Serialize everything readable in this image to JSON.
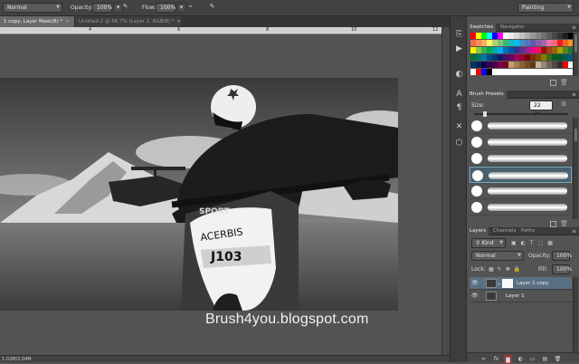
{
  "options_bar": {
    "mode_value": "Normal",
    "opacity_label": "Opacity:",
    "opacity_value": "100%",
    "flow_label": "Flow:",
    "flow_value": "100%",
    "workspace_value": "Painting"
  },
  "tabs": [
    {
      "label": "1 copy, Layer Mask/8) *",
      "close": "×"
    },
    {
      "label": "Untitled-2 @ 66.7% (Layer 2, RGB/8) *",
      "close": "×"
    }
  ],
  "ruler": {
    "ticks": [
      "",
      "4",
      "6",
      "8",
      "10",
      "12"
    ]
  },
  "status": {
    "doc_size": "1.02M/2.04M"
  },
  "watermark": "Brush4you.blogspot.com",
  "photo": {
    "bike_text": "J103",
    "fender_text": "ACERBIS",
    "shroud_text": "SPORT"
  },
  "swatches": {
    "tabs": [
      "Swatches",
      "Navigator"
    ],
    "colors": [
      [
        "#ff0000",
        "#ffff00",
        "#00ff00",
        "#00ffff",
        "#0000ff",
        "#ff00ff",
        "#ffffff",
        "#ebebeb",
        "#d6d6d6",
        "#c2c2c2",
        "#adadad",
        "#999999",
        "#858585",
        "#707070",
        "#5c5c5c",
        "#474747",
        "#333333",
        "#1f1f1f",
        "#000000"
      ],
      [
        "#f26c4f",
        "#f68e56",
        "#fbaf5d",
        "#fff467",
        "#acd373",
        "#7cc576",
        "#3bb878",
        "#1abbb4",
        "#00bff3",
        "#438ccb",
        "#5574b9",
        "#605ca8",
        "#855fa8",
        "#a763a8",
        "#f06ea9",
        "#f26d7d",
        "#ed1c24",
        "#f26522",
        "#f7941d"
      ],
      [
        "#fff200",
        "#8dc63f",
        "#39b54a",
        "#00a651",
        "#00a99d",
        "#00aeef",
        "#0072bc",
        "#0054a6",
        "#2e3192",
        "#662d91",
        "#92278f",
        "#ec008c",
        "#ed145b",
        "#9e0b0f",
        "#a0410d",
        "#a36209",
        "#aba000",
        "#598527",
        "#1a7b30"
      ],
      [
        "#007236",
        "#00746b",
        "#0076a3",
        "#004b80",
        "#003471",
        "#1b1464",
        "#440e62",
        "#630460",
        "#9e005d",
        "#9e0039",
        "#790000",
        "#7b2e00",
        "#7d4900",
        "#827b00",
        "#406618",
        "#005e20",
        "#005826",
        "#005952",
        "#005b7f"
      ],
      [
        "#003663",
        "#002157",
        "#0d004c",
        "#32004b",
        "#4b0049",
        "#7b0046",
        "#7a0026",
        "#c69c6d",
        "#a67c52",
        "#8c6239",
        "#754c24",
        "#603913",
        "#c7b299",
        "#998675",
        "#736357",
        "#534741",
        "#362f2d",
        "#ff0000",
        "#ffffff"
      ],
      [
        "#ffffff",
        "#ff0000",
        "#0000ff",
        "#000000",
        "#ffffff",
        "#ffffff",
        "#ffffff",
        "#ffffff",
        "#ffffff",
        "#ffffff",
        "#ffffff",
        "#ffffff",
        "#ffffff",
        "#ffffff",
        "#ffffff",
        "#ffffff",
        "#ffffff",
        "#ffffff",
        "#ffffff"
      ]
    ]
  },
  "brush_presets": {
    "tab": "Brush Presets",
    "size_label": "Size:",
    "size_value": "22 px",
    "count": 6
  },
  "layers": {
    "tabs": [
      "Layers",
      "Channels",
      "Paths"
    ],
    "kind_label": "Kind",
    "blend_value": "Normal",
    "opacity_label": "Opacity:",
    "opacity_value": "100%",
    "lock_label": "Lock:",
    "fill_label": "Fill:",
    "fill_value": "100%",
    "items": [
      {
        "name": "Layer 1 copy",
        "selected": true
      },
      {
        "name": "Layer 1",
        "selected": false
      }
    ]
  }
}
